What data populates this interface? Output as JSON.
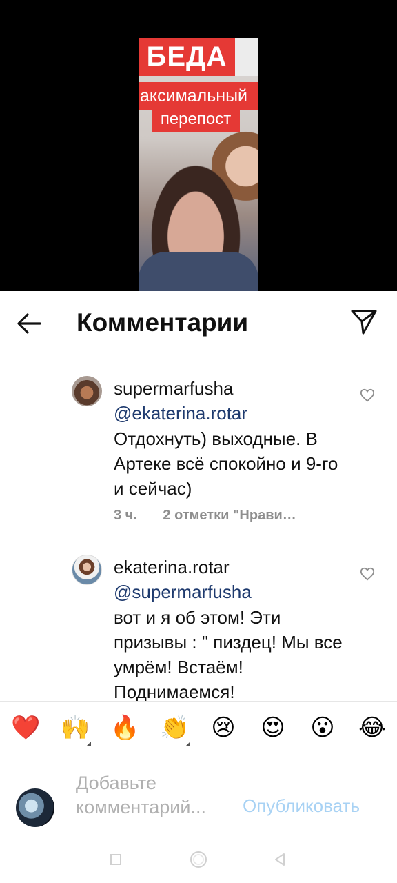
{
  "video": {
    "banner_line1": "БЕДА",
    "banner_line2": "аксимальный",
    "banner_line3": "перепост"
  },
  "header": {
    "title": "Комментарии",
    "back_icon": "arrow-left-icon",
    "share_icon": "paper-plane-icon"
  },
  "comments": [
    {
      "username": "supermarfusha",
      "mention": "@ekaterina.rotar",
      "text": "Отдохнуть) выходные. В Артеке всё спокойно и 9-го и сейчас)",
      "time": "3 ч.",
      "likes": "2 отметки \"Нрави…"
    },
    {
      "username": "ekaterina.rotar",
      "mention": "@supermarfusha",
      "text": "вот и я об этом! Эти призывы : \" пиздец! Мы все умрём! Встаём! Поднимаемся!"
    }
  ],
  "emoji_bar": [
    "❤️",
    "🙌",
    "🔥",
    "👏",
    "😢",
    "😍",
    "😮",
    "😂"
  ],
  "input": {
    "placeholder": "Добавьте комментарий...",
    "value": "",
    "publish_label": "Опубликовать"
  },
  "colors": {
    "mention": "#1e3a6e",
    "publish_disabled": "#a8d2f4",
    "banner_red": "#e53935"
  }
}
